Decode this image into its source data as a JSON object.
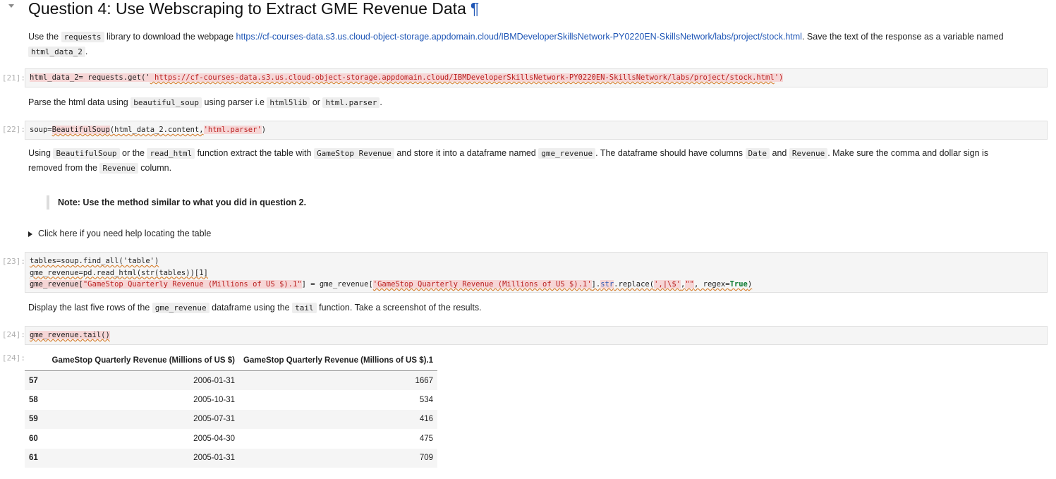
{
  "heading": {
    "text": "Question 4: Use Webscraping to Extract GME Revenue Data",
    "anchor": "¶"
  },
  "q4_text": {
    "p1_a": "Use the",
    "p1_code1": "requests",
    "p1_b": "library to download the webpage",
    "p1_url": "https://cf-courses-data.s3.us.cloud-object-storage.appdomain.cloud/IBMDeveloperSkillsNetwork-PY0220EN-SkillsNetwork/labs/project/stock.html",
    "p1_c": ". Save the text of the response as a variable named",
    "p1_code2": "html_data_2",
    "p1_d": "."
  },
  "cell21": {
    "prompt": "[21]:",
    "code_a": "html_data_2= requests.get('",
    "code_url": " https://cf-courses-data.s3.us.cloud-object-storage.appdomain.cloud/IBMDeveloperSkillsNetwork-PY0220EN-SkillsNetwork/labs/project/stock.html",
    "code_b": "')"
  },
  "parse_text": {
    "a": "Parse the html data using",
    "code1": "beautiful_soup",
    "b": "using parser i.e",
    "code2": "html5lib",
    "c": "or",
    "code3": "html.parser",
    "d": "."
  },
  "cell22": {
    "prompt": "[22]:",
    "code_a": "soup=",
    "code_fn": "BeautifulSoup",
    "code_b": "(html_data_2.content,",
    "code_str": "'html.parser'",
    "code_c": ")"
  },
  "extract_text": {
    "a": "Using",
    "code1": "BeautifulSoup",
    "b": "or the",
    "code2": "read_html",
    "c": "function extract the table with",
    "code3": "GameStop Revenue",
    "d": "and store it into a dataframe named",
    "code4": "gme_revenue",
    "e": ". The dataframe should have columns",
    "code5": "Date",
    "f": "and",
    "code6": "Revenue",
    "g": ". Make sure the comma and dollar sign is",
    "h": "removed from the",
    "code7": "Revenue",
    "i": "column."
  },
  "note": "Note: Use the method similar to what you did in question 2.",
  "details": "Click here if you need help locating the table",
  "cell23": {
    "prompt": "[23]:",
    "line1": "tables=soup.find_all('table')",
    "line2": "gme_revenue=pd.read_html(str(tables))[1]",
    "line3_a": "gme_revenue[",
    "line3_str1": "\"GameStop Quarterly Revenue (Millions of US $).1\"",
    "line3_b": "] = gme_revenue[",
    "line3_str2": "'GameStop Quarterly Revenue (Millions of US $).1'",
    "line3_c": "].",
    "line3_fn": "str",
    "line3_d": ".replace(",
    "line3_str3": "',|\\$'",
    "line3_e": ",",
    "line3_str4": "\"\"",
    "line3_f": ", regex=",
    "line3_true": "True",
    "line3_g": ")"
  },
  "display_text": {
    "a": "Display the last five rows of the",
    "code1": "gme_revenue",
    "b": "dataframe using the",
    "code2": "tail",
    "c": "function. Take a screenshot of the results."
  },
  "cell24": {
    "prompt": "[24]:",
    "code": "gme_revenue.tail()"
  },
  "out24": {
    "prompt": "[24]:",
    "columns": [
      "",
      "GameStop Quarterly Revenue (Millions of US $)",
      "GameStop Quarterly Revenue (Millions of US $).1"
    ],
    "rows": [
      [
        "57",
        "2006-01-31",
        "1667"
      ],
      [
        "58",
        "2005-10-31",
        "534"
      ],
      [
        "59",
        "2005-07-31",
        "416"
      ],
      [
        "60",
        "2005-04-30",
        "475"
      ],
      [
        "61",
        "2005-01-31",
        "709"
      ]
    ]
  }
}
